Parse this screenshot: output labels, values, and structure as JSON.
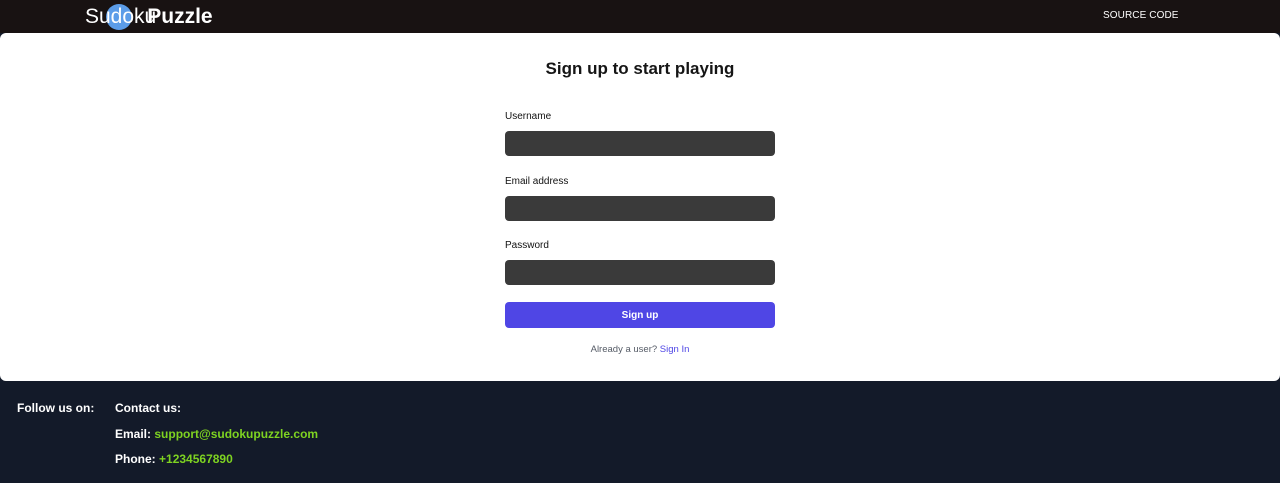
{
  "header": {
    "logo_part1": "Sudoku",
    "logo_part2": "Puzzle",
    "source_code_link": "SOURCE CODE"
  },
  "signup": {
    "title": "Sign up to start playing",
    "username_label": "Username",
    "username_value": "",
    "email_label": "Email address",
    "email_value": "",
    "password_label": "Password",
    "password_value": "",
    "submit_label": "Sign up",
    "existing_user_text": "Already a user?",
    "signin_link": "Sign In"
  },
  "footer": {
    "follow_label": "Follow us on:",
    "contact_heading": "Contact us:",
    "email_label": "Email:",
    "email_value": "support@sudokupuzzle.com",
    "phone_label": "Phone:",
    "phone_value": "+1234567890"
  },
  "colors": {
    "topbar_bg": "#181212",
    "footer_bg": "#131a29",
    "input_bg": "#3a3a3a",
    "primary_button": "#4f46e5",
    "link": "#4f46e5",
    "footer_accent": "#7ed321",
    "logo_circle": "#5b9ce8"
  }
}
